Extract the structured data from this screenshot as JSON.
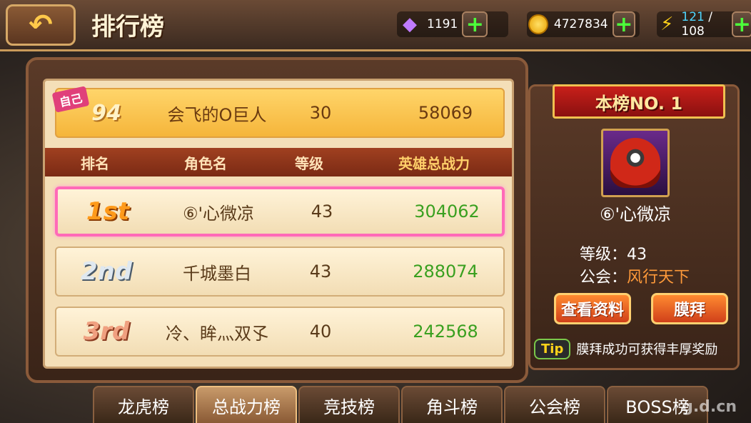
{
  "header": {
    "back_icon": "back-arrow-icon",
    "title": "排行榜",
    "gems": "1191",
    "gold": "4727834",
    "energy_current": "121",
    "energy_sep": " / ",
    "energy_max": "108",
    "plus": "+"
  },
  "self_entry": {
    "tag": "自己",
    "rank": "94",
    "name": "会飞的O巨人",
    "level": "30",
    "power": "58069"
  },
  "columns": {
    "rank": "排名",
    "name": "角色名",
    "level": "等级",
    "power": "英雄总战力"
  },
  "rows": [
    {
      "rank": "1st",
      "name": "⑥'心微凉",
      "level": "43",
      "power": "304062"
    },
    {
      "rank": "2nd",
      "name": "千城墨白",
      "level": "43",
      "power": "288074"
    },
    {
      "rank": "3rd",
      "name": "冷、眸灬双孓",
      "level": "40",
      "power": "242568"
    }
  ],
  "top_player": {
    "banner": "本榜NO. 1",
    "name": "⑥'心微凉",
    "level_label": "等级：",
    "level": "43",
    "guild_label": "公会：",
    "guild": "风行天下",
    "view_button": "查看资料",
    "worship_button": "膜拜",
    "tip_icon": "Tip",
    "tip_text": "膜拜成功可获得丰厚奖励"
  },
  "tabs": [
    "龙虎榜",
    "总战力榜",
    "竞技榜",
    "角斗榜",
    "公会榜",
    "BOSS榜"
  ],
  "active_tab": 1,
  "watermark": "g.d.cn"
}
